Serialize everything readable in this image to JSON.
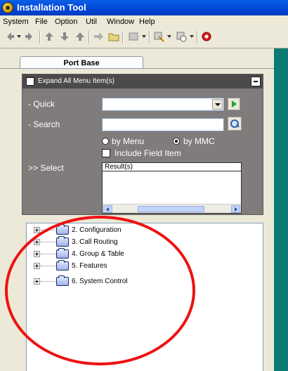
{
  "window": {
    "title": "Installation Tool"
  },
  "menu": [
    "System",
    "File",
    "Option",
    "Util",
    "Window",
    "Help"
  ],
  "toolbar": {
    "icons": [
      "back-icon",
      "forward-icon",
      "upload-icon",
      "download-icon",
      "up-icon",
      "open-folder-icon",
      "dropdown-icon",
      "settings-icon",
      "schedule-icon",
      "stop-icon"
    ]
  },
  "tab": {
    "label": "Port Base"
  },
  "panel": {
    "expand_all_label": "Expand All Menu Item(s)",
    "quick_label": "- Quick",
    "search_label": "- Search",
    "by_menu_label": "by Menu",
    "by_mmc_label": "by MMC",
    "include_field_label": "Include Field Item",
    "select_label": ">> Select",
    "result_header": "Result(s)",
    "quick_value": "",
    "search_value": ""
  },
  "tree": [
    {
      "label": "2. Configuration"
    },
    {
      "label": "3. Call Routing"
    },
    {
      "label": "4. Group & Table"
    },
    {
      "label": "5. Features"
    },
    {
      "label": "6. System Control"
    }
  ],
  "colors": {
    "titlebar": "#0046d5",
    "panel": "#807c7c",
    "annotation": "#ee1111",
    "side_strip": "#0b7a72"
  }
}
